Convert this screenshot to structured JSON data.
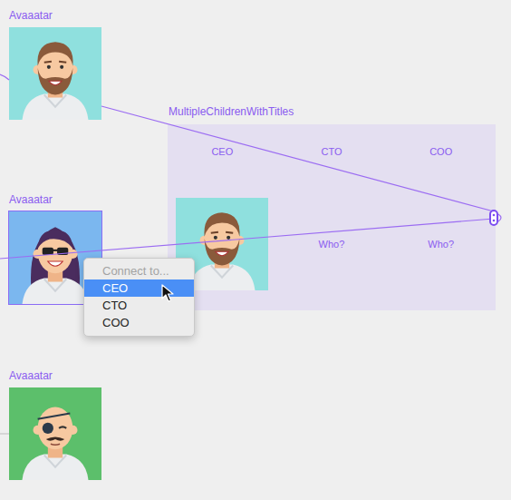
{
  "canvas": {
    "nodes": [
      {
        "label": "Avaaatar",
        "kind": "bearded",
        "color": "#8fe0de",
        "selected": false
      },
      {
        "label": "Avaaatar",
        "kind": "sunglasses",
        "color": "#7bb7ef",
        "selected": true
      },
      {
        "label": "Avaaatar",
        "kind": "eyepatch",
        "color": "#5cbf6b",
        "selected": false
      }
    ]
  },
  "frame": {
    "title": "MultipleChildrenWithTitles",
    "slots": [
      {
        "title": "CEO",
        "kind": "bearded",
        "color": "#8fe0de"
      },
      {
        "title": "CTO",
        "kind": "empty",
        "text": "Who?"
      },
      {
        "title": "COO",
        "kind": "empty",
        "text": "Who?"
      }
    ]
  },
  "menu": {
    "header": "Connect to...",
    "header_disabled": true,
    "items": [
      {
        "label": "CEO",
        "selected": true
      },
      {
        "label": "CTO",
        "selected": false
      },
      {
        "label": "COO",
        "selected": false
      }
    ]
  }
}
